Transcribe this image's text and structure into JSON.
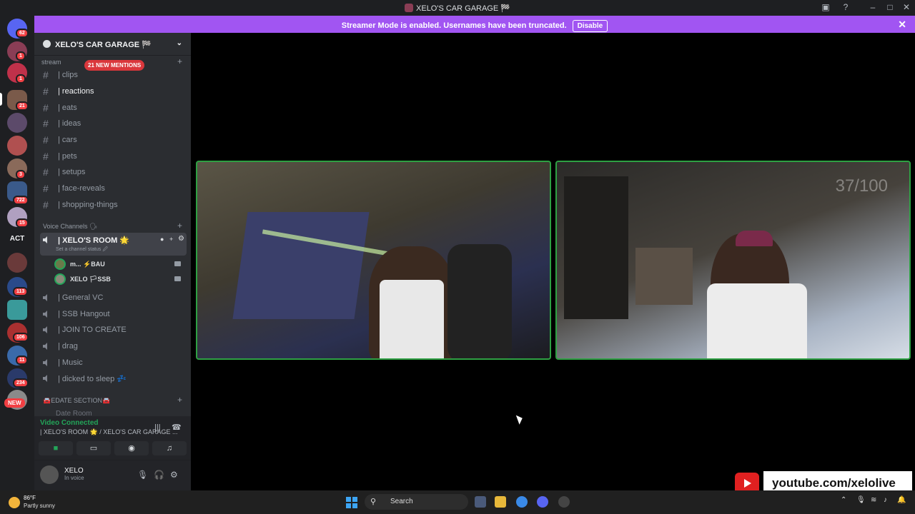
{
  "window": {
    "title": "XELO'S CAR GARAGE 🏁"
  },
  "banner": {
    "message": "Streamer Mode is enabled. Usernames have been truncated.",
    "disable_label": "Disable"
  },
  "guilds": {
    "badges": [
      "62",
      "1",
      "1",
      "21",
      "3",
      "722",
      "15",
      "113",
      "106",
      "11",
      "234"
    ],
    "act_label": "ACT",
    "new_label": "NEW",
    "colors": [
      "#5865f2",
      "#8a3d55",
      "#c0314a",
      "#7a5a4a",
      "#5c4a6a",
      "#b05050",
      "#8a6a5a",
      "#3a5a8a",
      "#b0a0c0",
      "#6a3a3a",
      "#2a4a8a",
      "#3a9a9a",
      "#aa3030",
      "#3a6aaa",
      "#2a3a6a",
      "#8a8a8a"
    ]
  },
  "server": {
    "name": "XELO'S CAR GARAGE 🏁"
  },
  "sidebar": {
    "mentions_label": "21 NEW MENTIONS",
    "category_stream": "stream",
    "text_channels": [
      "| clips",
      "| reactions",
      "| eats",
      "| ideas",
      "| cars",
      "| pets",
      "| setups",
      "| face-reveals",
      "| shopping-things"
    ],
    "category_voice": "Voice Channels 🗣",
    "voice_room": "| XELO'S ROOM 🌟",
    "voice_room_status": "Set a channel status 🖉",
    "members": [
      {
        "name": "m... ⚡BAU"
      },
      {
        "name": "XELO 🏳SSB"
      }
    ],
    "voice_channels": [
      "| General VC",
      "| SSB Hangout",
      "| JOIN TO CREATE",
      "| drag",
      "| Music",
      "| dicked to sleep 💤"
    ],
    "category_edate": "🚘EDATE SECTION🚘",
    "partial_channel": "Date Room"
  },
  "voice_panel": {
    "status": "Video Connected",
    "location": "| XELO'S ROOM 🌟 / XELO'S CAR GARAGE ..."
  },
  "user": {
    "name": "XELO",
    "status": "In voice"
  },
  "stage": {
    "counter": "37/100"
  },
  "overlay": {
    "youtube": "youtube.com/xelolive"
  },
  "taskbar": {
    "temp": "86°F",
    "condition": "Partly sunny",
    "search_placeholder": "Search"
  },
  "colors": {
    "accent": "#a155f2",
    "speaking": "#2ea043",
    "mention": "#da373c"
  }
}
